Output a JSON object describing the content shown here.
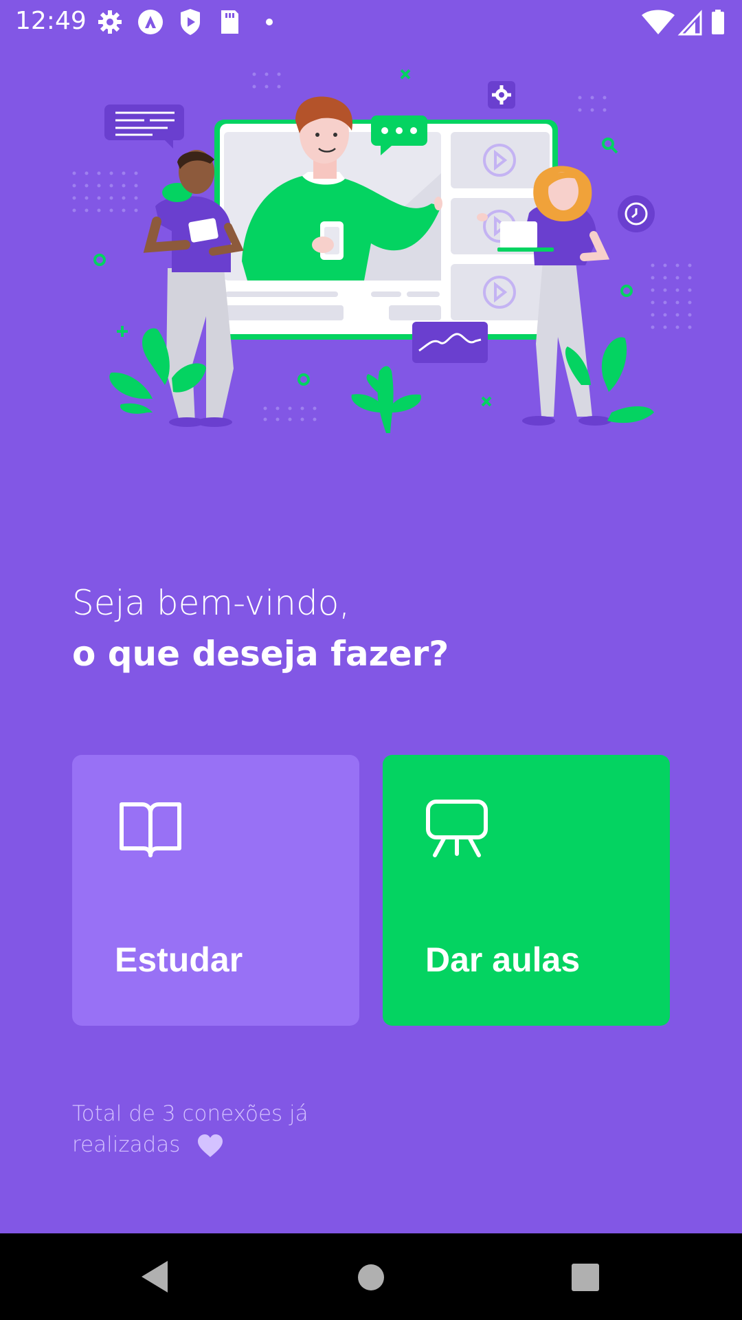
{
  "status_bar": {
    "time": "12:49",
    "left_icons": [
      "gear-icon",
      "app-a-icon",
      "shield-play-icon",
      "sd-card-icon",
      "dot-icon"
    ],
    "right_icons": [
      "wifi-icon",
      "signal-icon",
      "battery-icon"
    ]
  },
  "hero": {
    "illustration": "online-class-illustration"
  },
  "greeting": {
    "line1": "Seja bem-vindo,",
    "line2": "o que deseja fazer?"
  },
  "actions": {
    "study": {
      "label": "Estudar",
      "icon": "book-open-icon",
      "color": "#9871F5"
    },
    "teach": {
      "label": "Dar aulas",
      "icon": "presentation-icon",
      "color": "#04D361"
    }
  },
  "footer": {
    "connections_text_1": "Total de 3 conexões já",
    "connections_text_2": "realizadas",
    "heart_icon": "heart-icon"
  },
  "nav": {
    "back": "back-icon",
    "home": "home-icon",
    "recents": "recents-icon"
  },
  "colors": {
    "background": "#8257E5",
    "primary_light": "#9871F5",
    "secondary": "#04D361",
    "text_muted": "#D4C2FF"
  }
}
